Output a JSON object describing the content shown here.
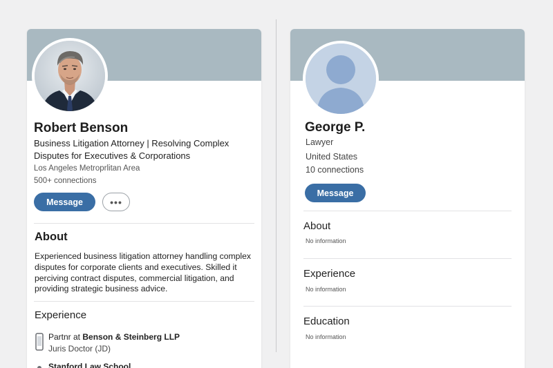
{
  "left_profile": {
    "name": "Robert Benson",
    "headline_line1": "Business Litigation Attorney | Resolving Complex",
    "headline_line2": "Disputes for Executives & Corporations",
    "location": "Los Angeles Metroprlitan Area",
    "connections": "500+ connections",
    "message_label": "Message",
    "more_label": "•••",
    "about": {
      "title": "About",
      "text_line1": "Experienced business litigation attorney handling complex",
      "text_line2": "disputes for corporate clients and executives. Skilled it",
      "text_line3": "perciving contract disputes, commercial litigation, and",
      "text_line4": "providing strategic business advice."
    },
    "experience": {
      "title": "Experience",
      "items": [
        {
          "role_prefix": "Partnr at ",
          "company": "Benson & Steinberg LLP",
          "subtitle": "Juris Doctor (JD)"
        },
        {
          "role_prefix": "",
          "company": "Stanford Law School",
          "subtitle": ""
        }
      ]
    }
  },
  "right_profile": {
    "name": "George P.",
    "headline": "Lawyer",
    "location": "United States",
    "connections": "10 connections",
    "message_label": "Message",
    "about": {
      "title": "About",
      "text": "No information"
    },
    "experience": {
      "title": "Experience",
      "text": "No information"
    },
    "education": {
      "title": "Education",
      "text": "No information"
    }
  },
  "colors": {
    "banner": "#a9b9c1",
    "primary_button": "#3a6ea5",
    "background": "#f0f0f1"
  }
}
